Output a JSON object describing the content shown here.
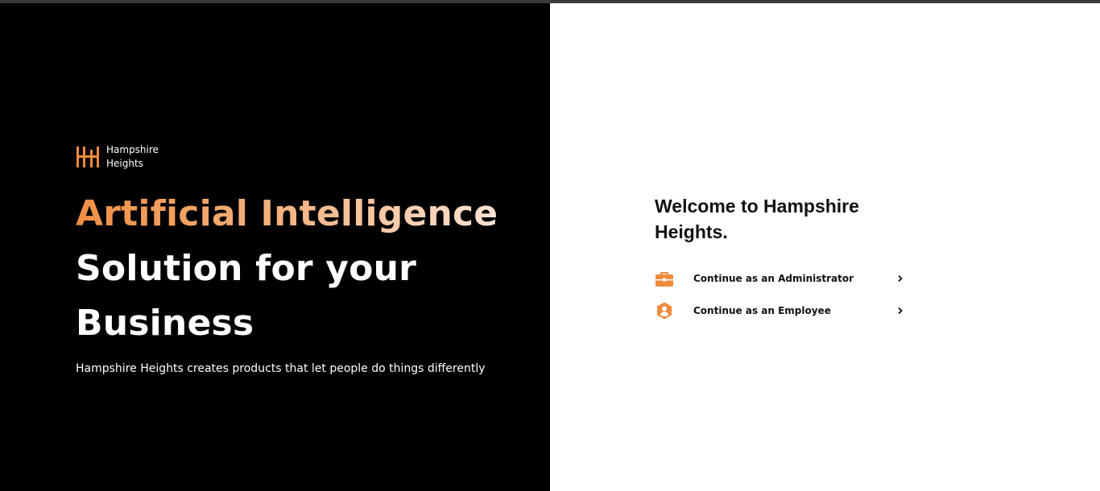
{
  "colors": {
    "accent": "#f08b3e",
    "left_background": "#000000",
    "right_background": "#ffffff"
  },
  "brand": {
    "name_line1": "Hampshire",
    "name_line2": "Heights"
  },
  "hero": {
    "headline_accent": "Artificial Intelligence",
    "headline_line2": "Solution for your",
    "headline_line3": "Business",
    "tagline": "Hampshire Heights creates products that let people do things differently"
  },
  "login": {
    "welcome": "Welcome to Hampshire Heights.",
    "options": [
      {
        "label": "Continue as an Administrator",
        "icon": "briefcase-icon"
      },
      {
        "label": "Continue as an Employee",
        "icon": "user-shield-icon"
      }
    ]
  }
}
